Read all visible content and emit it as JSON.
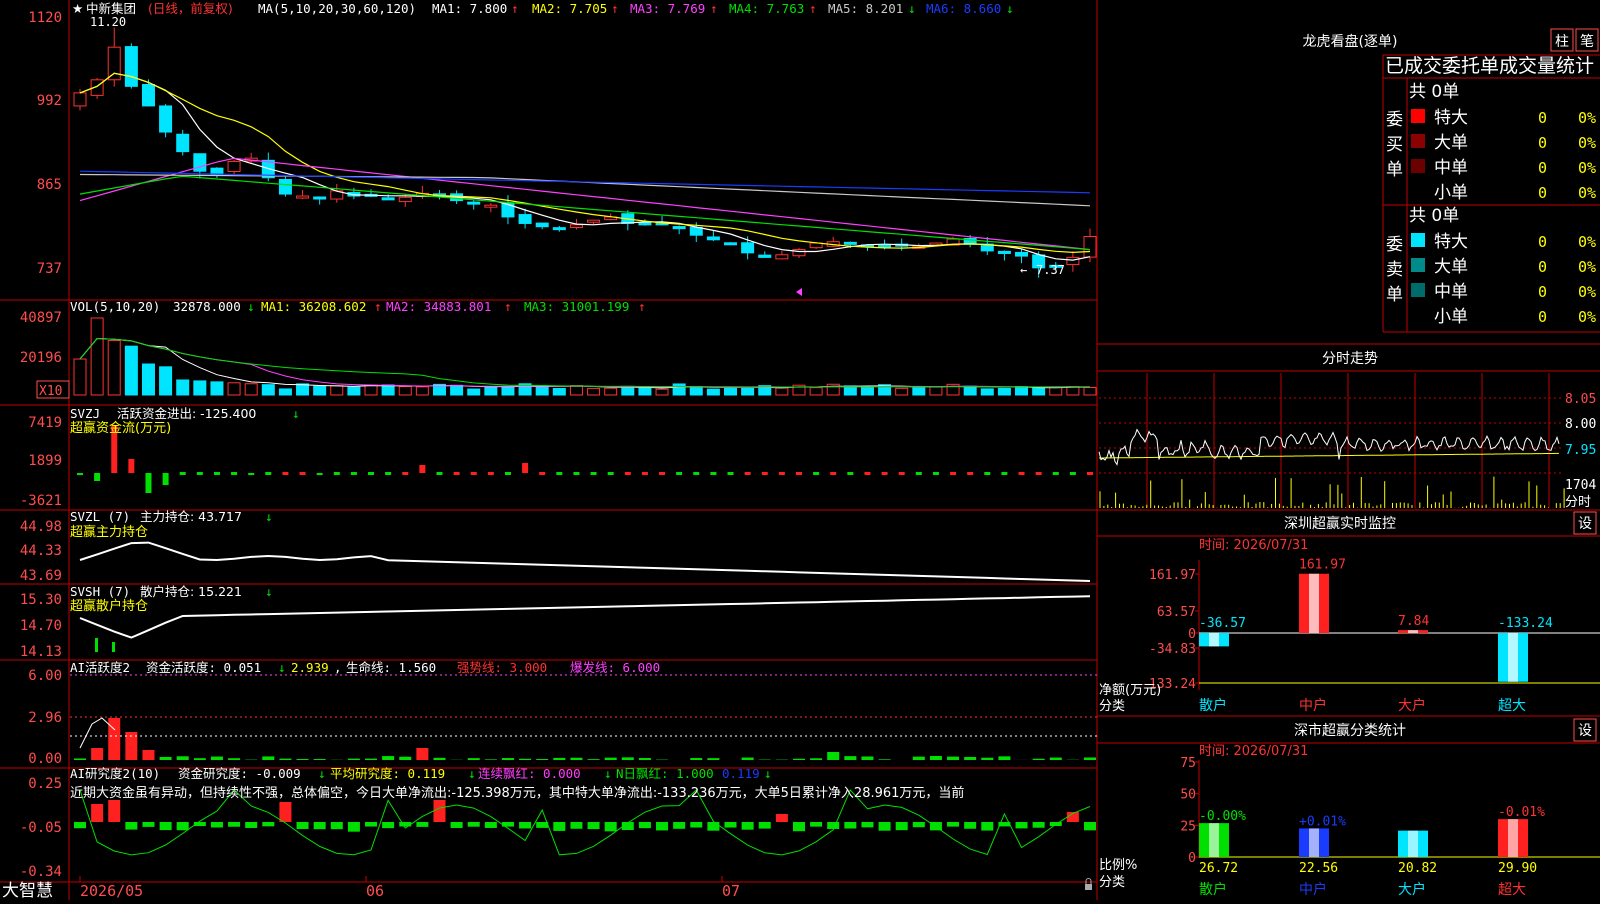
{
  "colors": {
    "up": "#ff3232",
    "down": "#00e5ff",
    "grid": "#c00000",
    "axis": "#ff4d4d",
    "ma1": "#ffffff",
    "ma2": "#ffff00",
    "ma3": "#ff40ff",
    "ma4": "#00e000",
    "ma5": "#c8c8c8",
    "ma6": "#1a3cff",
    "green": "#00e000",
    "yellow": "#ffff00",
    "magenta": "#ff40ff",
    "white": "#ffffff",
    "cyan": "#00e5ff",
    "red": "#ff2020",
    "blue": "#1a3cff"
  },
  "main": {
    "stock_name": "中新集团",
    "mode": "(日线，前复权)",
    "ma_def": "MA(5,10,20,30,60,120)",
    "ma1": "MA1: 7.800",
    "ma2": "MA2: 7.705",
    "ma3": "MA3: 7.769",
    "ma4": "MA4: 7.763",
    "ma5": "MA5: 8.201",
    "ma6": "MA6: 8.660",
    "y_ticks": [
      "1120",
      "992",
      "865",
      "737"
    ],
    "high_label": "11.20",
    "low_label": "7.37",
    "corner_tag": "X10"
  },
  "vol": {
    "label": "VOL(5,10,20)",
    "value": "32878.000",
    "ma1": "MA1: 36208.602",
    "ma2": "MA2: 34883.801",
    "ma3": "MA3: 31001.199",
    "y_ticks": [
      "40897",
      "20196"
    ],
    "unit": "X10"
  },
  "svzj": {
    "label": "SVZJ",
    "text": "活跃资金进出: -125.400",
    "sub": "超赢资金流(万元)",
    "y_ticks": [
      "7419",
      "1899",
      "-3621"
    ]
  },
  "svzl": {
    "label": "SVZL (7)",
    "text": "主力持仓: 43.717",
    "sub": "超赢主力持仓",
    "y_ticks": [
      "44.98",
      "44.33",
      "43.69"
    ]
  },
  "svsh": {
    "label": "SVSH (7)",
    "text": "散户持仓: 15.221",
    "sub": "超赢散户持仓",
    "y_ticks": [
      "15.30",
      "14.70",
      "14.13"
    ]
  },
  "ai1": {
    "label": "AI活跃度2",
    "t1": "资金活跃度: 0.051",
    "t2": "2.939",
    "t3": "生命线: 1.560",
    "t4": "强势线: 3.000",
    "t5": "爆发线: 6.000",
    "y_ticks": [
      "6.00",
      "2.96",
      "0.00"
    ]
  },
  "ai2": {
    "label": "AI研究度2(10)",
    "t1": "资金研究度: -0.009",
    "t2": "平均研究度: 0.119",
    "t3": "连续飘红: 0.000",
    "t4": "N日飘红: 1.000",
    "t5": "0.119",
    "note": "近期大资金虽有异动，但持续性不强，总体偏空，今日大单净流出:-125.398万元，其中特大单净流出:-133.236万元，大单5日累计净入28.961万元，当前",
    "y_ticks": [
      "0.25",
      "-0.05",
      "-0.34"
    ]
  },
  "xaxis": {
    "labels": [
      "2026/05",
      "06",
      "07"
    ],
    "brand": "大智慧"
  },
  "lhb": {
    "title": "龙虎看盘(逐单)",
    "btn1": "柱",
    "btn2": "笔",
    "header": "已成交委托单成交量统计",
    "buy": {
      "side": "委买单",
      "total": "共 0单",
      "rows": [
        {
          "name": "特大",
          "v": "0",
          "p": "0%"
        },
        {
          "name": "大单",
          "v": "0",
          "p": "0%"
        },
        {
          "name": "中单",
          "v": "0",
          "p": "0%"
        },
        {
          "name": "小单",
          "v": "0",
          "p": "0%"
        }
      ]
    },
    "sell": {
      "side": "委卖单",
      "total": "共 0单",
      "rows": [
        {
          "name": "特大",
          "v": "0",
          "p": "0%"
        },
        {
          "name": "大单",
          "v": "0",
          "p": "0%"
        },
        {
          "name": "中单",
          "v": "0",
          "p": "0%"
        },
        {
          "name": "小单",
          "v": "0",
          "p": "0%"
        }
      ]
    }
  },
  "fenshi": {
    "title": "分时走势",
    "y_ticks": [
      "8.05",
      "8.00",
      "7.95"
    ],
    "vol_tick": "1704",
    "vol_unit": "分时"
  },
  "monitor": {
    "title": "深圳超赢实时监控",
    "btn": "设",
    "date": "时间: 2026/07/31",
    "y_ticks": [
      "161.97",
      "63.57",
      "0",
      "-34.83",
      "-133.24"
    ],
    "ylabel": "净额(万元)",
    "xlabel": "分类",
    "categories": [
      "散户",
      "中户",
      "大户",
      "超大"
    ],
    "values": [
      -36.57,
      161.97,
      7.84,
      -133.24
    ],
    "labels": [
      "-36.57",
      "161.97",
      "7.84",
      "-133.24"
    ]
  },
  "stats": {
    "title": "深市超赢分类统计",
    "btn": "设",
    "date": "时间: 2026/07/31",
    "y_ticks": [
      "75",
      "50",
      "25",
      "0"
    ],
    "ylabel": "比例%",
    "xlabel": "分类",
    "categories": [
      "散户",
      "中户",
      "大户",
      "超大"
    ],
    "values": [
      26.72,
      22.56,
      20.82,
      29.9
    ],
    "labels": [
      "26.72",
      "22.56",
      "20.82",
      "29.90"
    ],
    "changes": [
      "-0.00%",
      "+0.01%",
      "",
      "-0.01%"
    ]
  },
  "chart_data": {
    "type": "candlestick",
    "title": "中新集团 (日线，前复权)",
    "x": [
      "2026/05",
      "06",
      "07"
    ],
    "y_axis_labels": [
      "1120",
      "992",
      "865",
      "737"
    ],
    "ma": {
      "MA1": 7.8,
      "MA2": 7.705,
      "MA3": 7.769,
      "MA4": 7.763,
      "MA5": 8.201,
      "MA6": 8.66
    },
    "high": 11.2,
    "low": 7.37,
    "volume_ma": {
      "MA1": 36208.602,
      "MA2": 34883.801,
      "MA3": 31001.199
    },
    "net_flow_wan": {
      "categories": [
        "散户",
        "中户",
        "大户",
        "超大"
      ],
      "values": [
        -36.57,
        161.97,
        7.84,
        -133.24
      ]
    },
    "ratio_pct": {
      "categories": [
        "散户",
        "中户",
        "大户",
        "超大"
      ],
      "values": [
        26.72,
        22.56,
        20.82,
        29.9
      ]
    }
  }
}
